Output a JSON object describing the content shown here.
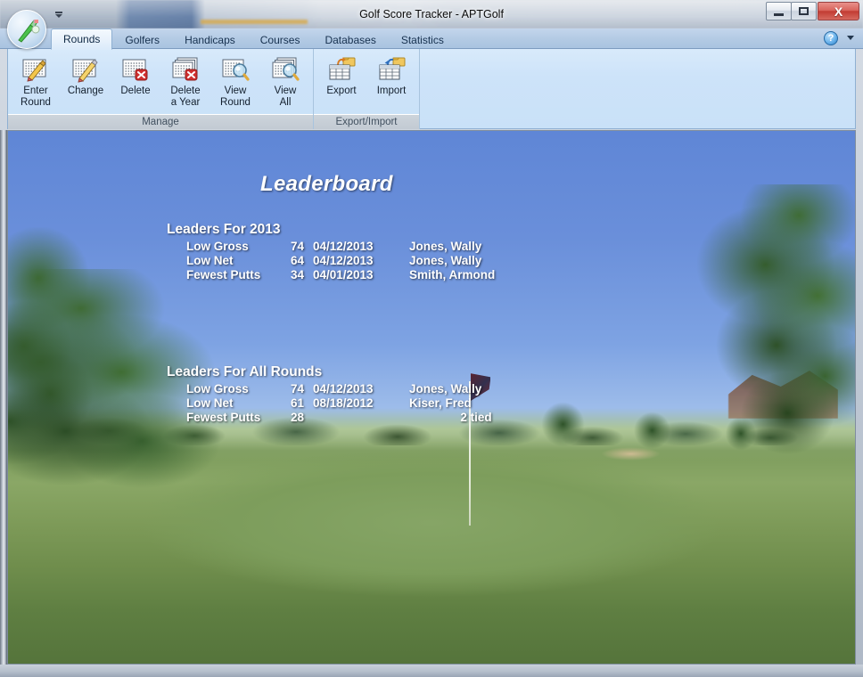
{
  "window": {
    "title": "Golf Score Tracker - APTGolf",
    "app_icon": "golf-club-icon",
    "quick_access_caret": "quick-access-toolbar-arrow",
    "controls": {
      "minimize": "minimize-icon",
      "maximize": "maximize-restore-icon",
      "close": "X"
    }
  },
  "ribbon": {
    "tabs": [
      {
        "label": "Rounds",
        "active": true
      },
      {
        "label": "Golfers",
        "active": false
      },
      {
        "label": "Handicaps",
        "active": false
      },
      {
        "label": "Courses",
        "active": false
      },
      {
        "label": "Databases",
        "active": false
      },
      {
        "label": "Statistics",
        "active": false
      }
    ],
    "help": {
      "glyph": "?",
      "icon": "help-icon",
      "caret": "chevron-down-icon"
    },
    "groups": [
      {
        "label": "Manage",
        "buttons": [
          {
            "label": "Enter\nRound",
            "icon": "page-pencil-icon"
          },
          {
            "label": "Change",
            "icon": "page-pencil-edit-icon"
          },
          {
            "label": "Delete",
            "icon": "page-delete-icon"
          },
          {
            "label": "Delete\na Year",
            "icon": "pages-delete-icon"
          },
          {
            "label": "View\nRound",
            "icon": "page-magnifier-icon"
          },
          {
            "label": "View\nAll",
            "icon": "pages-magnifier-icon"
          }
        ]
      },
      {
        "label": "Export/Import",
        "buttons": [
          {
            "label": "Export",
            "icon": "grid-export-folder-icon"
          },
          {
            "label": "Import",
            "icon": "grid-import-folder-icon"
          }
        ]
      }
    ]
  },
  "leaderboard": {
    "title": "Leaderboard",
    "sections": [
      {
        "heading": "Leaders For 2013",
        "rows": [
          {
            "label": "Low Gross",
            "score": "74",
            "date": "04/12/2013",
            "name": "Jones, Wally",
            "center": false
          },
          {
            "label": "Low Net",
            "score": "64",
            "date": "04/12/2013",
            "name": "Jones, Wally",
            "center": false
          },
          {
            "label": "Fewest Putts",
            "score": "34",
            "date": "04/01/2013",
            "name": "Smith, Armond",
            "center": false
          }
        ]
      },
      {
        "heading": "Leaders For All Rounds",
        "rows": [
          {
            "label": "Low Gross",
            "score": "74",
            "date": "04/12/2013",
            "name": "Jones, Wally",
            "center": false
          },
          {
            "label": "Low Net",
            "score": "61",
            "date": "08/18/2012",
            "name": "Kiser, Fred",
            "center": false
          },
          {
            "label": "Fewest Putts",
            "score": "28",
            "date": "",
            "name": "2 tied",
            "center": true
          }
        ]
      }
    ]
  },
  "colors": {
    "ribbon_bg": "#cde3f9",
    "tab_active_bg": "#e7f1fb",
    "close_button": "#c23c33",
    "sky": "#6f96de",
    "grass": "#7d9c5d",
    "text_white": "#ffffff"
  }
}
